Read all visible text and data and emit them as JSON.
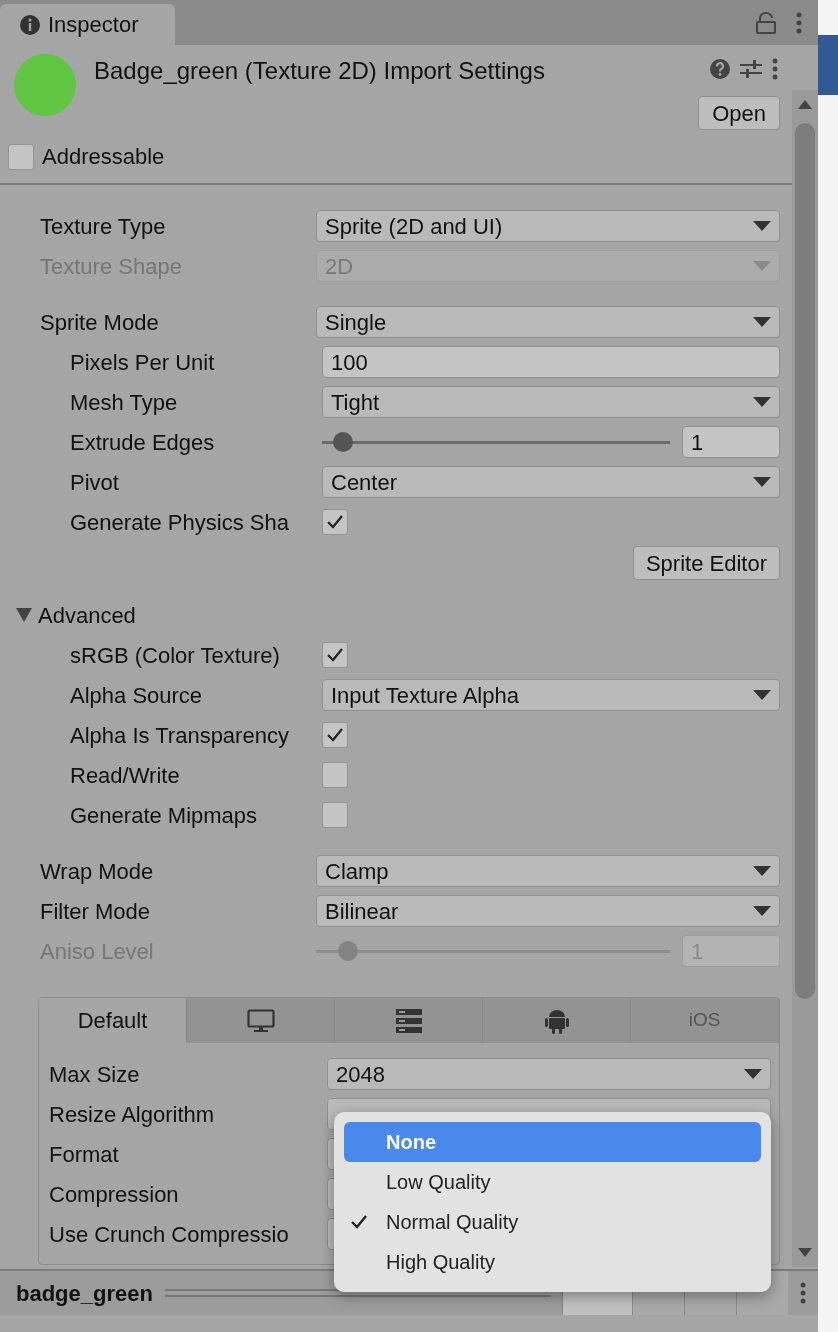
{
  "tab": {
    "title": "Inspector",
    "selected": true
  },
  "header": {
    "title": "Badge_green (Texture 2D) Import Settings",
    "open_button": "Open",
    "addressable": {
      "label": "Addressable",
      "checked": false
    }
  },
  "sections": [
    {
      "rows": [
        {
          "kind": "dropdown",
          "label": "Texture Type",
          "value": "Sprite (2D and UI)",
          "disabled": false
        },
        {
          "kind": "dropdown",
          "label": "Texture Shape",
          "value": "2D",
          "disabled": true
        }
      ]
    },
    {
      "rows": [
        {
          "kind": "dropdown",
          "label": "Sprite Mode",
          "value": "Single",
          "disabled": false,
          "children": [
            {
              "kind": "text",
              "label": "Pixels Per Unit",
              "value": "100"
            },
            {
              "kind": "dropdown",
              "label": "Mesh Type",
              "value": "Tight",
              "disabled": false
            },
            {
              "kind": "slider",
              "label": "Extrude Edges",
              "level": 0.06,
              "value": "1",
              "disabled": false
            },
            {
              "kind": "dropdown",
              "label": "Pivot",
              "value": "Center",
              "disabled": false
            },
            {
              "kind": "checkbox",
              "label": "Generate Physics Sha",
              "checked": true
            }
          ]
        },
        {
          "kind": "button",
          "label": "Sprite Editor"
        },
        {
          "kind": "foldout",
          "label": "Advanced",
          "expanded": true,
          "children": [
            {
              "kind": "checkbox",
              "label": "sRGB (Color Texture)",
              "checked": true
            },
            {
              "kind": "dropdown",
              "label": "Alpha Source",
              "value": "Input Texture Alpha",
              "disabled": false
            },
            {
              "kind": "checkbox",
              "label": "Alpha Is Transparency",
              "checked": true
            },
            {
              "kind": "checkbox",
              "label": "Read/Write",
              "checked": false
            },
            {
              "kind": "checkbox",
              "label": "Generate Mipmaps",
              "checked": false
            }
          ]
        }
      ]
    },
    {
      "rows": [
        {
          "kind": "dropdown",
          "label": "Wrap Mode",
          "value": "Clamp",
          "disabled": false
        },
        {
          "kind": "dropdown",
          "label": "Filter Mode",
          "value": "Bilinear",
          "disabled": false
        },
        {
          "kind": "slider",
          "label": "Aniso Level",
          "level": 0.09,
          "value": "1",
          "disabled": true
        }
      ]
    }
  ],
  "platform": {
    "tabs": [
      {
        "kind": "text",
        "label": "Default",
        "selected": true
      },
      {
        "kind": "monitor",
        "selected": false
      },
      {
        "kind": "server",
        "selected": false
      },
      {
        "kind": "android",
        "selected": false
      },
      {
        "kind": "text",
        "label": "iOS",
        "selected": false
      }
    ],
    "rows": [
      {
        "kind": "dropdown",
        "label": "Max Size",
        "value": "2048"
      },
      {
        "kind": "field",
        "label": "Resize Algorithm"
      },
      {
        "kind": "field",
        "label": "Format"
      },
      {
        "kind": "field",
        "label": "Compression"
      },
      {
        "kind": "field",
        "label": "Use Crunch Compressio"
      }
    ]
  },
  "menu": {
    "items": [
      {
        "label": "None",
        "selected": true,
        "checked": false
      },
      {
        "label": "Low Quality",
        "selected": false,
        "checked": false
      },
      {
        "label": "Normal Quality",
        "selected": false,
        "checked": true
      },
      {
        "label": "High Quality",
        "selected": false,
        "checked": false
      }
    ]
  },
  "preview_bar": {
    "name": "badge_green",
    "channels": [
      {
        "selected": true
      },
      {
        "selected": false
      },
      {
        "selected": false
      },
      {
        "selected": false
      }
    ]
  }
}
